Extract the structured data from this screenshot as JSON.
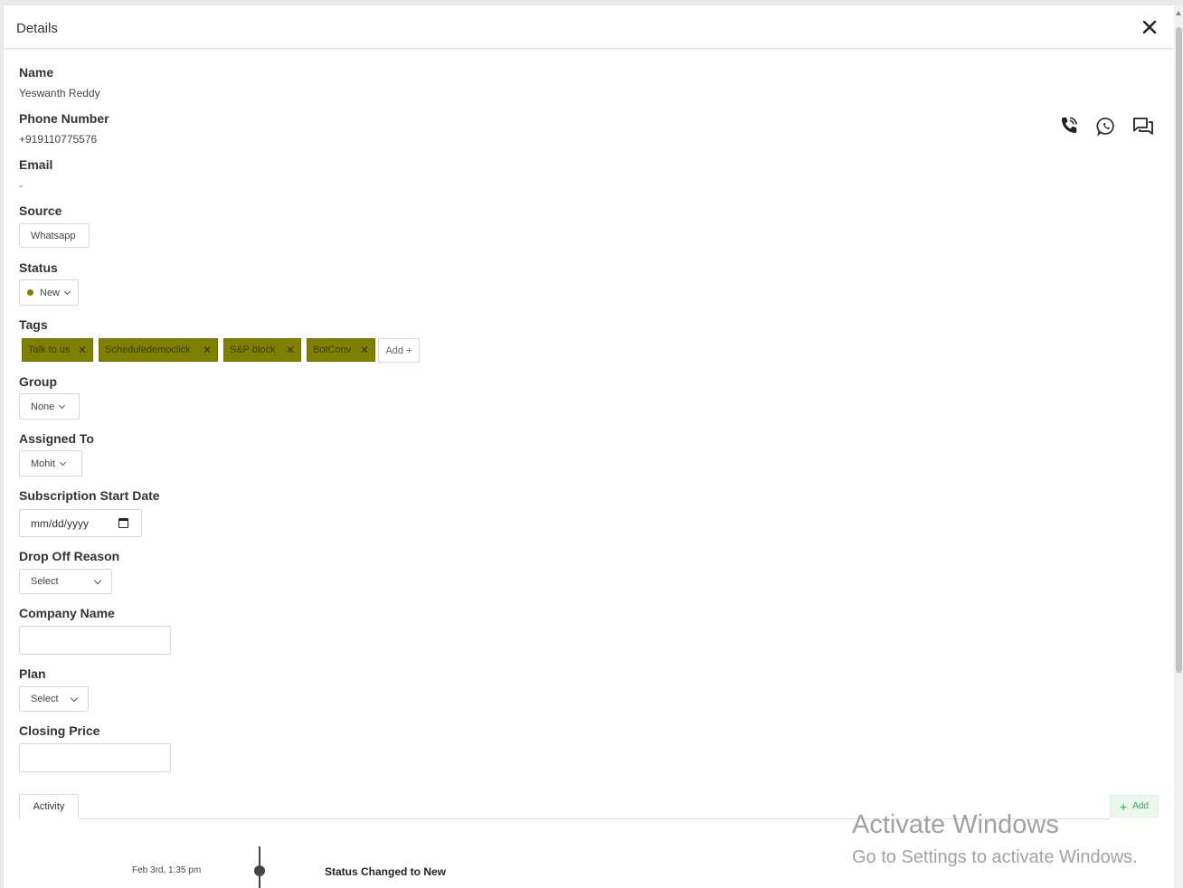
{
  "header": {
    "title": "Details"
  },
  "fields": {
    "name": {
      "label": "Name",
      "value": "Yeswanth Reddy"
    },
    "phone": {
      "label": "Phone Number",
      "value": "+919110775576"
    },
    "email": {
      "label": "Email",
      "value": "-"
    },
    "source": {
      "label": "Source",
      "value": "Whatsapp"
    },
    "status": {
      "label": "Status",
      "value": "New",
      "dot_color": "#7f8000"
    },
    "tags": {
      "label": "Tags",
      "items": [
        "Talk to us",
        "Scheduledemoclick",
        "S&P block",
        "BotConv"
      ],
      "add_label": "Add +",
      "tag_color": "#808000"
    },
    "group": {
      "label": "Group",
      "value": "None"
    },
    "assigned_to": {
      "label": "Assigned To",
      "value": "Mohit"
    },
    "subscription_start_date": {
      "label": "Subscription Start Date",
      "placeholder": "mm/dd/yyyy"
    },
    "drop_off_reason": {
      "label": "Drop Off Reason",
      "value": "Select"
    },
    "company_name": {
      "label": "Company Name",
      "value": ""
    },
    "plan": {
      "label": "Plan",
      "value": "Select"
    },
    "closing_price": {
      "label": "Closing Price",
      "value": ""
    }
  },
  "contact_icons": [
    "phone-call-icon",
    "whatsapp-icon",
    "chat-icon"
  ],
  "activity": {
    "tab_label": "Activity",
    "add_label": "Add",
    "entries": [
      {
        "time": "Feb 3rd, 1:35 pm",
        "text": "Status Changed to New"
      }
    ]
  },
  "watermark": {
    "title": "Activate Windows",
    "subtitle": "Go to Settings to activate Windows."
  }
}
